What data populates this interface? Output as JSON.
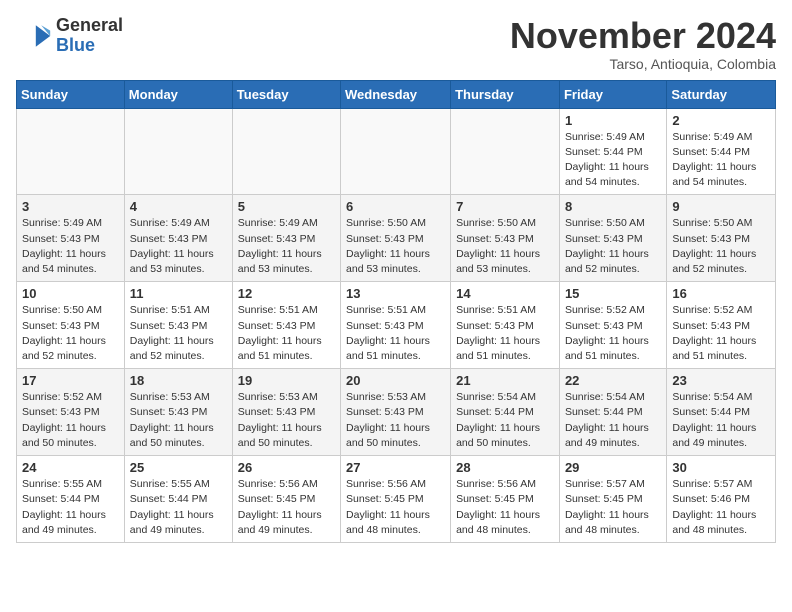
{
  "logo": {
    "general": "General",
    "blue": "Blue"
  },
  "title": "November 2024",
  "location": "Tarso, Antioquia, Colombia",
  "days_of_week": [
    "Sunday",
    "Monday",
    "Tuesday",
    "Wednesday",
    "Thursday",
    "Friday",
    "Saturday"
  ],
  "weeks": [
    [
      {
        "day": "",
        "info": ""
      },
      {
        "day": "",
        "info": ""
      },
      {
        "day": "",
        "info": ""
      },
      {
        "day": "",
        "info": ""
      },
      {
        "day": "",
        "info": ""
      },
      {
        "day": "1",
        "info": "Sunrise: 5:49 AM\nSunset: 5:44 PM\nDaylight: 11 hours\nand 54 minutes."
      },
      {
        "day": "2",
        "info": "Sunrise: 5:49 AM\nSunset: 5:44 PM\nDaylight: 11 hours\nand 54 minutes."
      }
    ],
    [
      {
        "day": "3",
        "info": "Sunrise: 5:49 AM\nSunset: 5:43 PM\nDaylight: 11 hours\nand 54 minutes."
      },
      {
        "day": "4",
        "info": "Sunrise: 5:49 AM\nSunset: 5:43 PM\nDaylight: 11 hours\nand 53 minutes."
      },
      {
        "day": "5",
        "info": "Sunrise: 5:49 AM\nSunset: 5:43 PM\nDaylight: 11 hours\nand 53 minutes."
      },
      {
        "day": "6",
        "info": "Sunrise: 5:50 AM\nSunset: 5:43 PM\nDaylight: 11 hours\nand 53 minutes."
      },
      {
        "day": "7",
        "info": "Sunrise: 5:50 AM\nSunset: 5:43 PM\nDaylight: 11 hours\nand 53 minutes."
      },
      {
        "day": "8",
        "info": "Sunrise: 5:50 AM\nSunset: 5:43 PM\nDaylight: 11 hours\nand 52 minutes."
      },
      {
        "day": "9",
        "info": "Sunrise: 5:50 AM\nSunset: 5:43 PM\nDaylight: 11 hours\nand 52 minutes."
      }
    ],
    [
      {
        "day": "10",
        "info": "Sunrise: 5:50 AM\nSunset: 5:43 PM\nDaylight: 11 hours\nand 52 minutes."
      },
      {
        "day": "11",
        "info": "Sunrise: 5:51 AM\nSunset: 5:43 PM\nDaylight: 11 hours\nand 52 minutes."
      },
      {
        "day": "12",
        "info": "Sunrise: 5:51 AM\nSunset: 5:43 PM\nDaylight: 11 hours\nand 51 minutes."
      },
      {
        "day": "13",
        "info": "Sunrise: 5:51 AM\nSunset: 5:43 PM\nDaylight: 11 hours\nand 51 minutes."
      },
      {
        "day": "14",
        "info": "Sunrise: 5:51 AM\nSunset: 5:43 PM\nDaylight: 11 hours\nand 51 minutes."
      },
      {
        "day": "15",
        "info": "Sunrise: 5:52 AM\nSunset: 5:43 PM\nDaylight: 11 hours\nand 51 minutes."
      },
      {
        "day": "16",
        "info": "Sunrise: 5:52 AM\nSunset: 5:43 PM\nDaylight: 11 hours\nand 51 minutes."
      }
    ],
    [
      {
        "day": "17",
        "info": "Sunrise: 5:52 AM\nSunset: 5:43 PM\nDaylight: 11 hours\nand 50 minutes."
      },
      {
        "day": "18",
        "info": "Sunrise: 5:53 AM\nSunset: 5:43 PM\nDaylight: 11 hours\nand 50 minutes."
      },
      {
        "day": "19",
        "info": "Sunrise: 5:53 AM\nSunset: 5:43 PM\nDaylight: 11 hours\nand 50 minutes."
      },
      {
        "day": "20",
        "info": "Sunrise: 5:53 AM\nSunset: 5:43 PM\nDaylight: 11 hours\nand 50 minutes."
      },
      {
        "day": "21",
        "info": "Sunrise: 5:54 AM\nSunset: 5:44 PM\nDaylight: 11 hours\nand 50 minutes."
      },
      {
        "day": "22",
        "info": "Sunrise: 5:54 AM\nSunset: 5:44 PM\nDaylight: 11 hours\nand 49 minutes."
      },
      {
        "day": "23",
        "info": "Sunrise: 5:54 AM\nSunset: 5:44 PM\nDaylight: 11 hours\nand 49 minutes."
      }
    ],
    [
      {
        "day": "24",
        "info": "Sunrise: 5:55 AM\nSunset: 5:44 PM\nDaylight: 11 hours\nand 49 minutes."
      },
      {
        "day": "25",
        "info": "Sunrise: 5:55 AM\nSunset: 5:44 PM\nDaylight: 11 hours\nand 49 minutes."
      },
      {
        "day": "26",
        "info": "Sunrise: 5:56 AM\nSunset: 5:45 PM\nDaylight: 11 hours\nand 49 minutes."
      },
      {
        "day": "27",
        "info": "Sunrise: 5:56 AM\nSunset: 5:45 PM\nDaylight: 11 hours\nand 48 minutes."
      },
      {
        "day": "28",
        "info": "Sunrise: 5:56 AM\nSunset: 5:45 PM\nDaylight: 11 hours\nand 48 minutes."
      },
      {
        "day": "29",
        "info": "Sunrise: 5:57 AM\nSunset: 5:45 PM\nDaylight: 11 hours\nand 48 minutes."
      },
      {
        "day": "30",
        "info": "Sunrise: 5:57 AM\nSunset: 5:46 PM\nDaylight: 11 hours\nand 48 minutes."
      }
    ]
  ]
}
